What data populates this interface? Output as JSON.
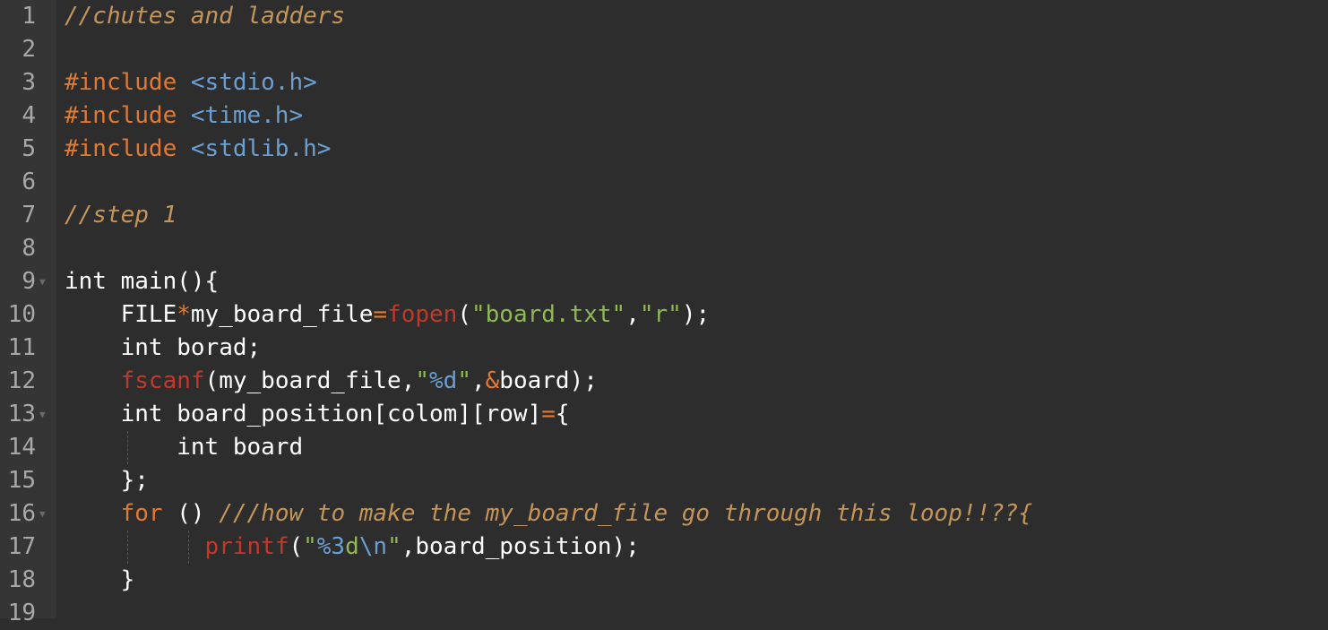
{
  "editor": {
    "line_numbers": [
      "1",
      "2",
      "3",
      "4",
      "5",
      "6",
      "7",
      "8",
      "9",
      "10",
      "11",
      "12",
      "13",
      "14",
      "15",
      "16",
      "17",
      "18",
      "19"
    ],
    "fold_markers": [
      "9",
      "13",
      "16"
    ],
    "lines": {
      "l1": {
        "comment": "//chutes and ladders"
      },
      "l3": {
        "pp": "#include",
        "hdr": "<stdio.h>"
      },
      "l4": {
        "pp": "#include",
        "hdr": "<time.h>"
      },
      "l5": {
        "pp": "#include",
        "hdr": "<stdlib.h>"
      },
      "l7": {
        "comment": "//step 1"
      },
      "l9": {
        "text": "int main(){"
      },
      "l10": {
        "a": "FILE",
        "star": "*",
        "b": "my_board_file",
        "eq": "=",
        "fn": "fopen",
        "p1": "(",
        "s1": "\"board.txt\"",
        "comma": ",",
        "s2": "\"r\"",
        "end": ");"
      },
      "l11": {
        "text": "int borad;"
      },
      "l12": {
        "fn": "fscanf",
        "a": "(my_board_file,",
        "q1": "\"",
        "fmt": "%d",
        "q2": "\"",
        "comma": ",",
        "amp": "&",
        "b": "board);"
      },
      "l13": {
        "a": "int board_position[colom][row]",
        "eq": "=",
        "b": "{"
      },
      "l14": {
        "text": "int board"
      },
      "l15": {
        "text": "};"
      },
      "l16": {
        "kw": "for",
        "a": " () ",
        "comment": "///how to make the my_board_file go through this loop!!??{"
      },
      "l17": {
        "fn": "printf",
        "p1": "(",
        "q1": "\"",
        "fmt": "%3",
        "d": "d",
        "esc": "\\n",
        "q2": "\"",
        "b": ",board_position);"
      },
      "l18": {
        "text": "}"
      }
    }
  }
}
